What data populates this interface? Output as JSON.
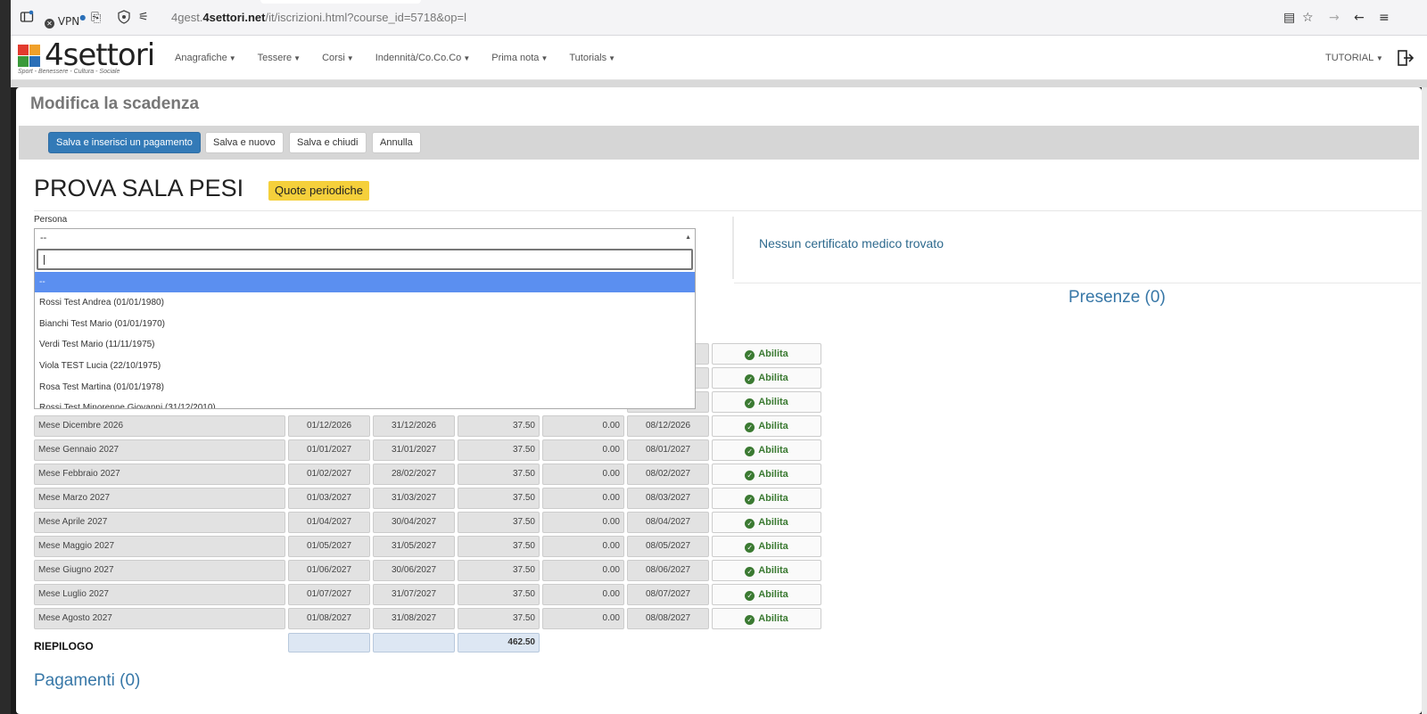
{
  "browser": {
    "vpn_label": "VPN",
    "url_prefix": "4gest.",
    "url_domain": "4settori.net",
    "url_path": "/it/iscrizioni.html?course_id=5718&op=l"
  },
  "logo": {
    "word": "4settori",
    "tagline": "Sport - Benessere - Cultura - Sociale",
    "colors": [
      "#e23b2e",
      "#f0a02a",
      "#3a9a3a",
      "#2a6fb8"
    ]
  },
  "nav": {
    "items": [
      {
        "label": "Anagrafiche"
      },
      {
        "label": "Tessere"
      },
      {
        "label": "Corsi"
      },
      {
        "label": "Indennità/Co.Co.Co"
      },
      {
        "label": "Prima nota"
      },
      {
        "label": "Tutorials"
      }
    ],
    "user_menu": "TUTORIAL"
  },
  "page": {
    "title": "Modifica la scadenza",
    "toolbar": {
      "save_payment": "Salva e inserisci un pagamento",
      "save_new": "Salva e nuovo",
      "save_close": "Salva e chiudi",
      "cancel": "Annulla"
    },
    "course_name": "PROVA SALA PESI",
    "course_badge": "Quote periodiche",
    "persona_label": "Persona",
    "persona_value": "--",
    "no_certificate": "Nessun certificato medico trovato",
    "presenze": "Presenze (0)",
    "riepilogo_label": "RIEPILOGO",
    "riepilogo_total": "462.50",
    "pagamenti": "Pagamenti (0)"
  },
  "dropdown": {
    "options": [
      "--",
      "Rossi Test Andrea (01/01/1980)",
      "Bianchi Test Mario (01/01/1970)",
      "Verdi Test Mario (11/11/1975)",
      "Viola TEST Lucia (22/10/1975)",
      "Rosa Test Martina (01/01/1978)",
      "Rossi Test Minorenne Giovanni (31/12/2010)"
    ],
    "selected_index": 0
  },
  "schedule": {
    "action_label": "Abilita",
    "rows": [
      {
        "name": "Mese Dicembre 2026",
        "start": "01/12/2026",
        "end": "31/12/2026",
        "amount": "37.50",
        "paid": "0.00",
        "due": "08/12/2026"
      },
      {
        "name": "Mese Gennaio 2027",
        "start": "01/01/2027",
        "end": "31/01/2027",
        "amount": "37.50",
        "paid": "0.00",
        "due": "08/01/2027"
      },
      {
        "name": "Mese Febbraio 2027",
        "start": "01/02/2027",
        "end": "28/02/2027",
        "amount": "37.50",
        "paid": "0.00",
        "due": "08/02/2027"
      },
      {
        "name": "Mese Marzo 2027",
        "start": "01/03/2027",
        "end": "31/03/2027",
        "amount": "37.50",
        "paid": "0.00",
        "due": "08/03/2027"
      },
      {
        "name": "Mese Aprile 2027",
        "start": "01/04/2027",
        "end": "30/04/2027",
        "amount": "37.50",
        "paid": "0.00",
        "due": "08/04/2027"
      },
      {
        "name": "Mese Maggio 2027",
        "start": "01/05/2027",
        "end": "31/05/2027",
        "amount": "37.50",
        "paid": "0.00",
        "due": "08/05/2027"
      },
      {
        "name": "Mese Giugno 2027",
        "start": "01/06/2027",
        "end": "30/06/2027",
        "amount": "37.50",
        "paid": "0.00",
        "due": "08/06/2027"
      },
      {
        "name": "Mese Luglio 2027",
        "start": "01/07/2027",
        "end": "31/07/2027",
        "amount": "37.50",
        "paid": "0.00",
        "due": "08/07/2027"
      },
      {
        "name": "Mese Agosto 2027",
        "start": "01/08/2027",
        "end": "31/08/2027",
        "amount": "37.50",
        "paid": "0.00",
        "due": "08/08/2027"
      }
    ]
  }
}
